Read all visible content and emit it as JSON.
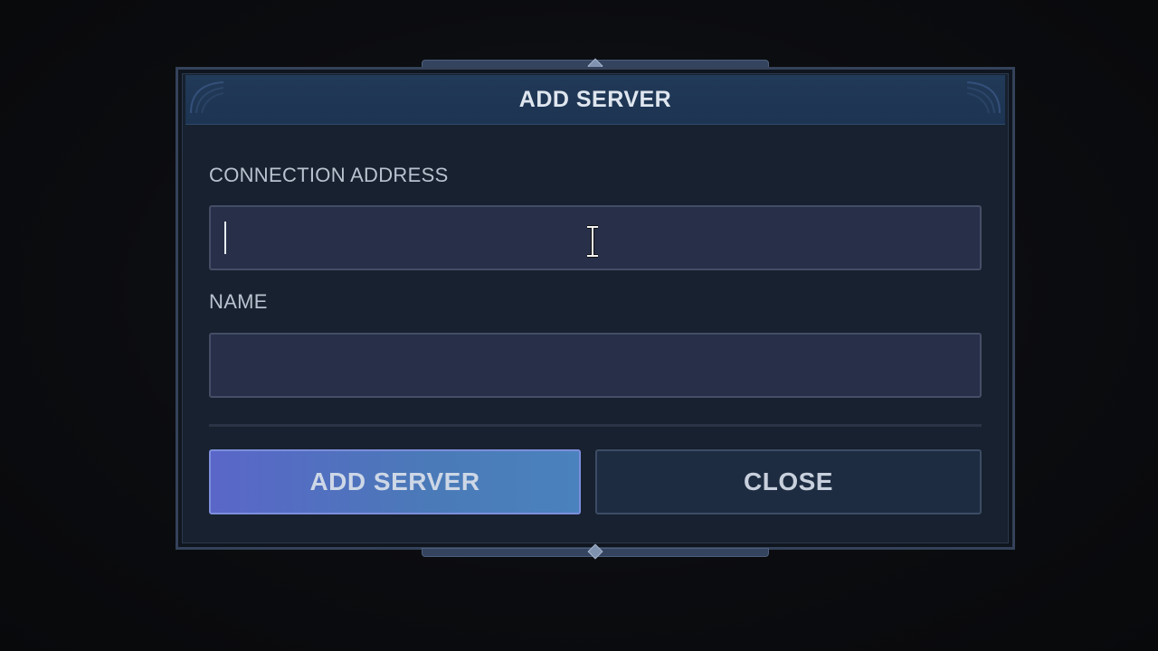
{
  "dialog": {
    "title": "ADD SERVER"
  },
  "fields": {
    "connection_address": {
      "label": "CONNECTION ADDRESS",
      "value": "",
      "placeholder": ""
    },
    "name": {
      "label": "NAME",
      "value": "",
      "placeholder": ""
    }
  },
  "buttons": {
    "add_server_label": "ADD SERVER",
    "close_label": "CLOSE"
  },
  "colors": {
    "accent_button": "#4a7ab8",
    "dialog_background": "#17212f",
    "header_background": "#213a58",
    "input_background": "#272f49"
  },
  "icons": {
    "cursor": "text-cursor-ibeam-icon"
  }
}
